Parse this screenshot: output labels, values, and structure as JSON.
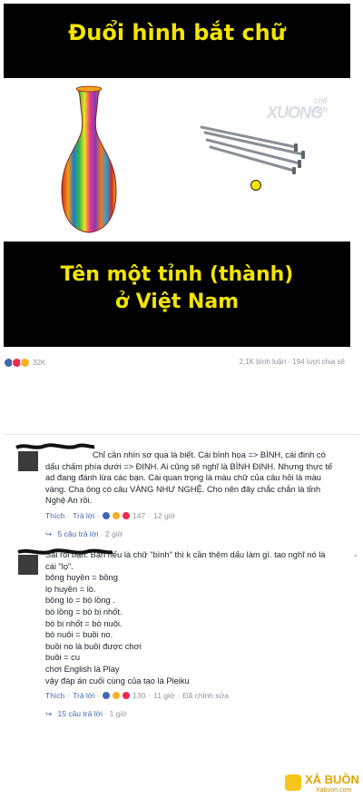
{
  "post": {
    "title": "Đuổi hình bắt chữ",
    "answer_line1": "Tên một tỉnh (thành)",
    "answer_line2": "ở Việt Nam",
    "watermark_sub": "chế ảnh",
    "watermark_main": "XUONG",
    "reaction_count": "32K",
    "stats": "2,1K bình luận · 194 lượt chia sẻ"
  },
  "comments": [
    {
      "lines": [
        "Chỉ cần nhìn sơ qua là biết. Cái bình họa => BÌNH, cái đinh có",
        "dấu chấm phía dưới => ĐỊNH. Ai cũng sẽ nghĩ là BÌNH ĐỊNH. Nhưng thực tế",
        "ad đang đánh lừa các bạn. Cái quan trọng là màu chữ của câu hỏi là màu",
        "vàng. Cha ông có câu VÀNG NHƯ NGHỆ. Cho nên đây chắc chắn là tỉnh",
        "Nghệ An rồi."
      ],
      "like": "Thích",
      "reply": "Trả lời",
      "reactions": "147",
      "time": "12 giờ",
      "replies_count": "5 câu trả lời",
      "replies_time": "2 giờ"
    },
    {
      "lines": [
        "Sai rồi bạn. Bạn nếu là chữ \"bình\" thì k cần thêm dấu làm gì. tao nghĩ nó là",
        "cái \"lọ\".",
        "bông huyền = bồng",
        "lọ huyền = lò.",
        "bồng lò = bò lồng .",
        "bò lồng = bò bị nhốt.",
        "bò bị nhốt = bò nuôi.",
        "bò nuôi = buồi no.",
        "buồi no là buồi được chơi",
        "buồi = cu",
        "chơi English là Play",
        "vậy đáp án cuối cùng của tao là Pleiku"
      ],
      "like": "Thích",
      "reply": "Trả lời",
      "reactions": "130",
      "time": "11 giờ",
      "edited": "Đã chỉnh sửa",
      "replies_count": "15 câu trả lời",
      "replies_time": "1 giờ"
    }
  ],
  "brand": {
    "name": "XẢ BUỒN",
    "domain": "Xabuon.com"
  }
}
